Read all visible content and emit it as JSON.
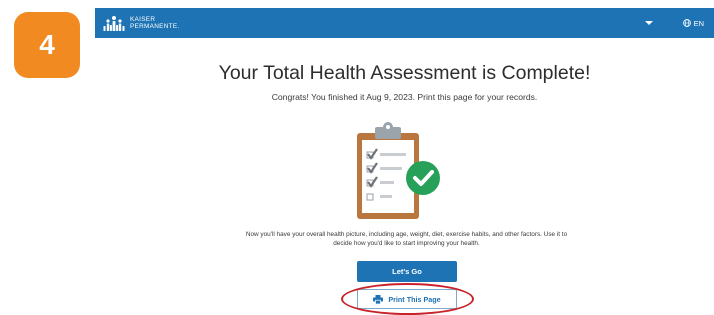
{
  "step": {
    "number": "4",
    "color": "#f28a22"
  },
  "header": {
    "brand_line1": "KAISER",
    "brand_line2": "PERMANENTE.",
    "language": "EN",
    "bar_color": "#1e73b4"
  },
  "main": {
    "title": "Your Total Health Assessment is Complete!",
    "subtitle": "Congrats! You finished it Aug 9, 2023. Print this page for your records.",
    "illustration": "clipboard-checklist-with-green-checkmark",
    "description": "Now you'll have your overall health picture, including age, weight, diet, exercise habits, and other factors. Use it to decide how you'd like to start improving your health.",
    "primary_button": "Let's Go",
    "print_button": "Print This Page"
  },
  "icons": {
    "menu": "chevron-down-icon",
    "language": "globe-icon",
    "print": "printer-icon"
  },
  "annotation_color": "#c8222a"
}
